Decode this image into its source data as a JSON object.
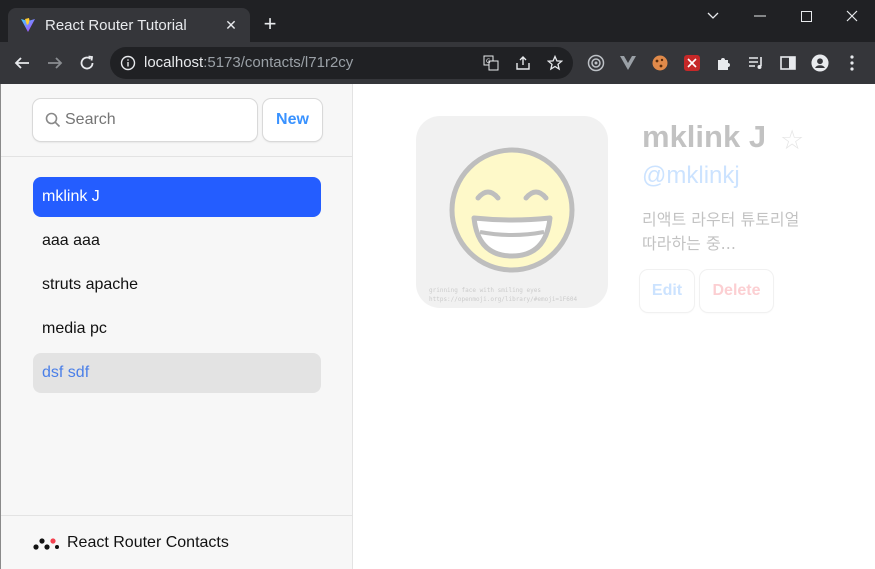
{
  "browser": {
    "tab_title": "React Router Tutorial",
    "url_host": "localhost",
    "url_path": ":5173/contacts/l71r2cy",
    "colors": {
      "frame": "#202124",
      "toolbar": "#35363a"
    }
  },
  "sidebar": {
    "search_placeholder": "Search",
    "new_button_label": "New",
    "contacts": [
      {
        "name": "mklink J",
        "state": "active"
      },
      {
        "name": "aaa aaa",
        "state": "normal"
      },
      {
        "name": "struts apache",
        "state": "normal"
      },
      {
        "name": "media pc",
        "state": "normal"
      },
      {
        "name": "dsf sdf",
        "state": "pending"
      }
    ],
    "footer_title": "React Router Contacts"
  },
  "contact": {
    "name": "mklink J",
    "favorite_icon": "☆",
    "twitter": "@mklinkj",
    "notes": "리액트 라우터 튜토리얼 따라하는 중...",
    "avatar_caption_line1": "grinning face with smiling eyes",
    "avatar_caption_line2": "https://openmoji.org/library/#emoji=1F604",
    "edit_label": "Edit",
    "delete_label": "Delete"
  },
  "colors": {
    "accent": "#245dff",
    "link": "#3992ff",
    "danger": "#f44250"
  }
}
